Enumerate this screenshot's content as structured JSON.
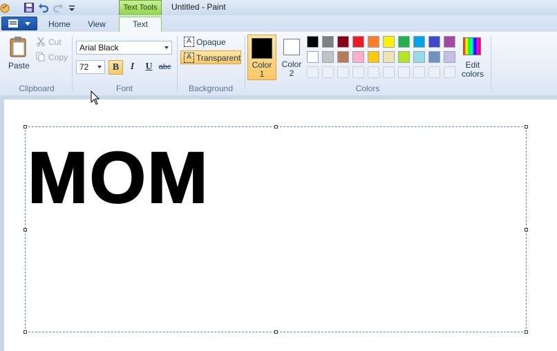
{
  "window": {
    "title": "Untitled - Paint",
    "context_tab": "Text Tools"
  },
  "tabs": [
    {
      "label": "Home"
    },
    {
      "label": "View"
    },
    {
      "label": "Text"
    }
  ],
  "clipboard": {
    "paste": "Paste",
    "cut": "Cut",
    "copy": "Copy",
    "group": "Clipboard"
  },
  "font": {
    "name": "Arial Black",
    "size": "72",
    "bold": "B",
    "italic": "I",
    "underline": "U",
    "strike": "abc",
    "group": "Font"
  },
  "background": {
    "opaque": "Opaque",
    "transparent": "Transparent",
    "group": "Background",
    "icon_letter": "A"
  },
  "colors": {
    "color1_l1": "Color",
    "color1_l2": "1",
    "color2_l1": "Color",
    "color2_l2": "2",
    "edit_l1": "Edit",
    "edit_l2": "colors",
    "group": "Colors",
    "color1_value": "#000000",
    "color2_value": "#ffffff",
    "palette_row1": [
      "#000000",
      "#7f7f7f",
      "#880015",
      "#ed1c24",
      "#ff7f27",
      "#fff200",
      "#22b14c",
      "#00a2e8",
      "#3f48cc",
      "#a349a4"
    ],
    "palette_row2": [
      "#ffffff",
      "#c3c3c3",
      "#b97a57",
      "#ffaec9",
      "#ffc90e",
      "#efe4b0",
      "#b5e61d",
      "#99d9ea",
      "#7092be",
      "#c8bfe7"
    ]
  },
  "canvas": {
    "text": "MOM"
  }
}
